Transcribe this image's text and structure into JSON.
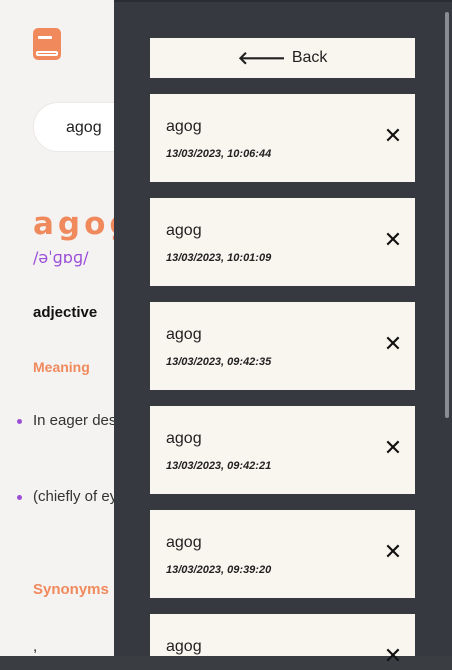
{
  "search": {
    "value": "agog"
  },
  "entry": {
    "word": "agog",
    "phonetic": "/əˈɡɒɡ/",
    "part_of_speech": "adjective",
    "meaning_label": "Meaning",
    "definitions": [
      "In eager des",
      "(chiefly of ey"
    ],
    "synonyms_label": "Synonyms",
    "synonym_trailing": ","
  },
  "history": {
    "back_label": "Back",
    "back_icon": "arrow-left",
    "close_icon": "x-mark",
    "items": [
      {
        "word": "agog",
        "timestamp": "13/03/2023, 10:06:44"
      },
      {
        "word": "agog",
        "timestamp": "13/03/2023, 10:01:09"
      },
      {
        "word": "agog",
        "timestamp": "13/03/2023, 09:42:35"
      },
      {
        "word": "agog",
        "timestamp": "13/03/2023, 09:42:21"
      },
      {
        "word": "agog",
        "timestamp": "13/03/2023, 09:39:20"
      },
      {
        "word": "agog",
        "timestamp": ""
      }
    ]
  },
  "colors": {
    "accent": "#f08a5d",
    "phonetic": "#9b4fd6",
    "drawer_bg": "#363a40",
    "card_bg": "#f9f6ef"
  }
}
